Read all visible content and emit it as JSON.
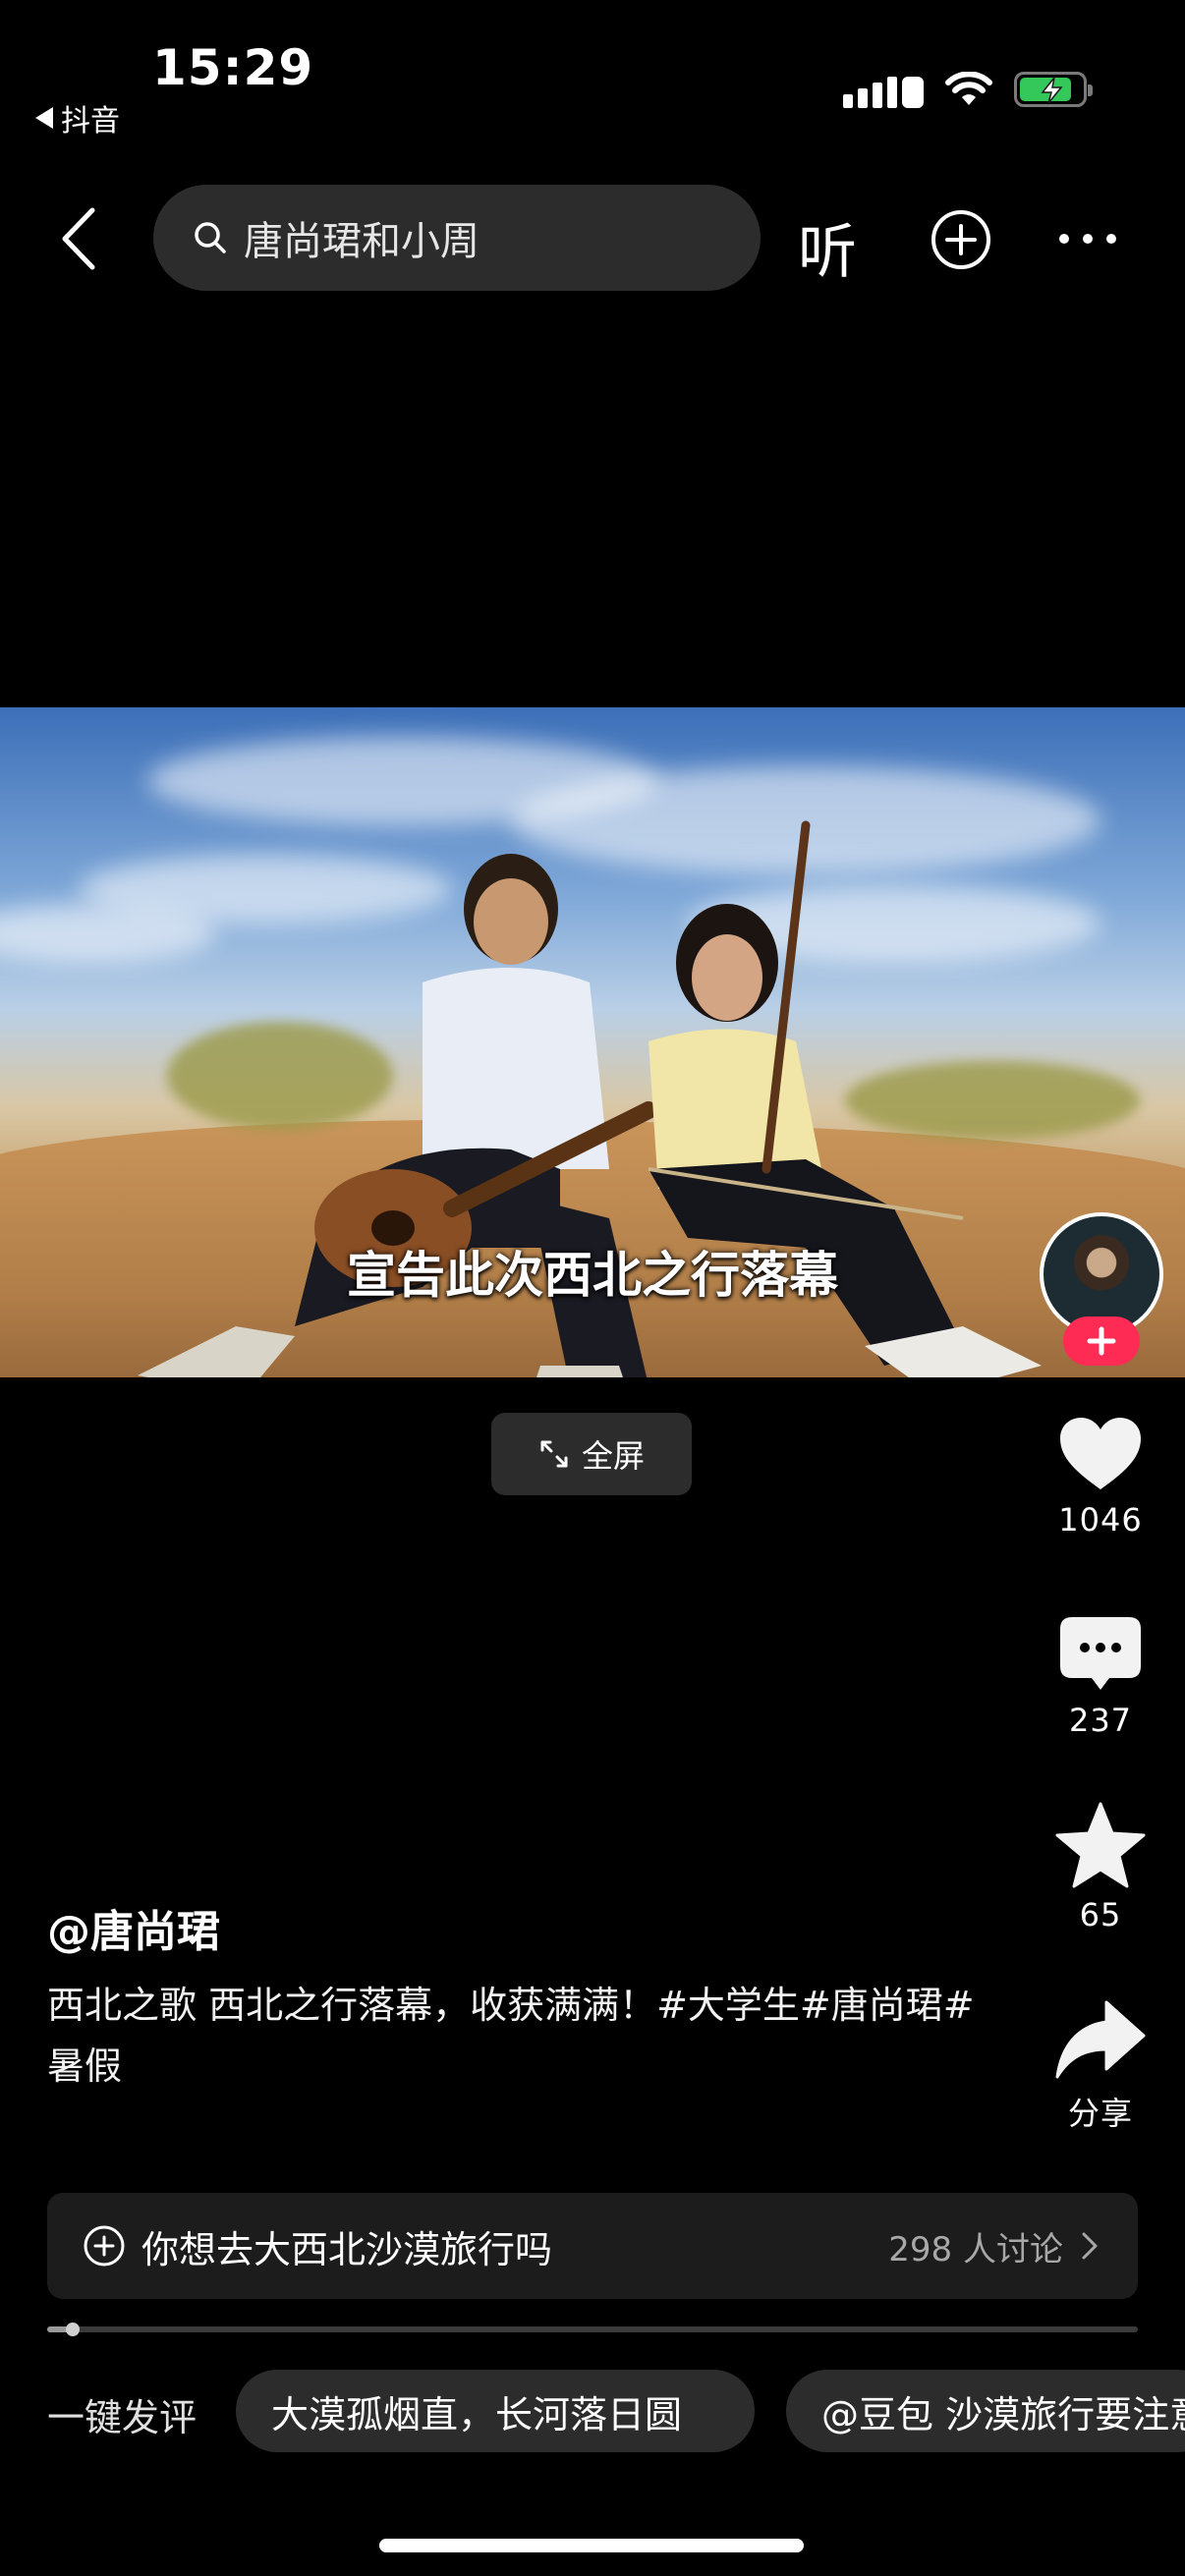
{
  "status_bar": {
    "time": "15:29",
    "back_app": "抖音",
    "battery_color": "#34c759"
  },
  "nav": {
    "back_icon": "chevron-left-icon",
    "search_icon": "search-icon",
    "search_text": "唐尚珺和小周",
    "listen_label": "听",
    "add_icon": "plus-circle-icon",
    "more_icon": "more-horizontal-icon"
  },
  "video": {
    "subtitle": "宣告此次西北之行落幕",
    "fullscreen_label": "全屏"
  },
  "actions": {
    "likes": "1046",
    "comments": "237",
    "favorites": "65",
    "share_label": "分享",
    "accent": "#fe2c55"
  },
  "post": {
    "author": "@唐尚珺",
    "description": "西北之歌 西北之行落幕，收获满满！#大学生#唐尚珺#暑假"
  },
  "topic": {
    "text": "你想去大西北沙漠旅行吗",
    "count": "298 人讨论"
  },
  "playback": {
    "progress_fraction": 0.023
  },
  "quick_comment": {
    "label": "一键发评",
    "chips": [
      "大漠孤烟直，长河落日圆",
      "@豆包 沙漠旅行要注意"
    ]
  }
}
